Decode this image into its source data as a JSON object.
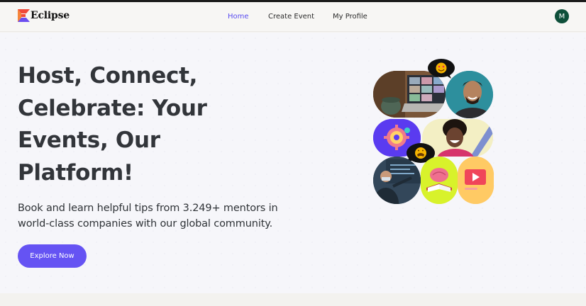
{
  "brand": {
    "name": "Eclipse",
    "icon": "eclipse-logo-icon"
  },
  "nav": {
    "links": [
      {
        "label": "Home",
        "active": true
      },
      {
        "label": "Create Event",
        "active": false
      },
      {
        "label": "My Profile",
        "active": false
      }
    ],
    "avatar_initial": "M"
  },
  "hero": {
    "headline_lines": [
      "Host, Connect,",
      "Celebrate: Your",
      "Events, Our",
      "Platform!"
    ],
    "subtext_lines": [
      "Book and learn helpful tips from 3.249+ mentors in",
      "world-class companies with our global community."
    ],
    "cta_label": "Explore Now"
  },
  "collage": {
    "tiles": [
      "laptop-video-call-photo",
      "smiling-man-photo",
      "brain-gear-illustration",
      "laughing-woman-photo",
      "presenter-whiteboard-photo",
      "book-brain-illustration",
      "video-play-illustration"
    ],
    "bubbles": [
      "heart-eyes-emoji-bubble",
      "grimace-emoji-bubble"
    ]
  },
  "colors": {
    "accent": "#6553f3",
    "active_link": "#5a4df0",
    "avatar_bg": "#0e4f3a",
    "headline": "#32353a"
  }
}
